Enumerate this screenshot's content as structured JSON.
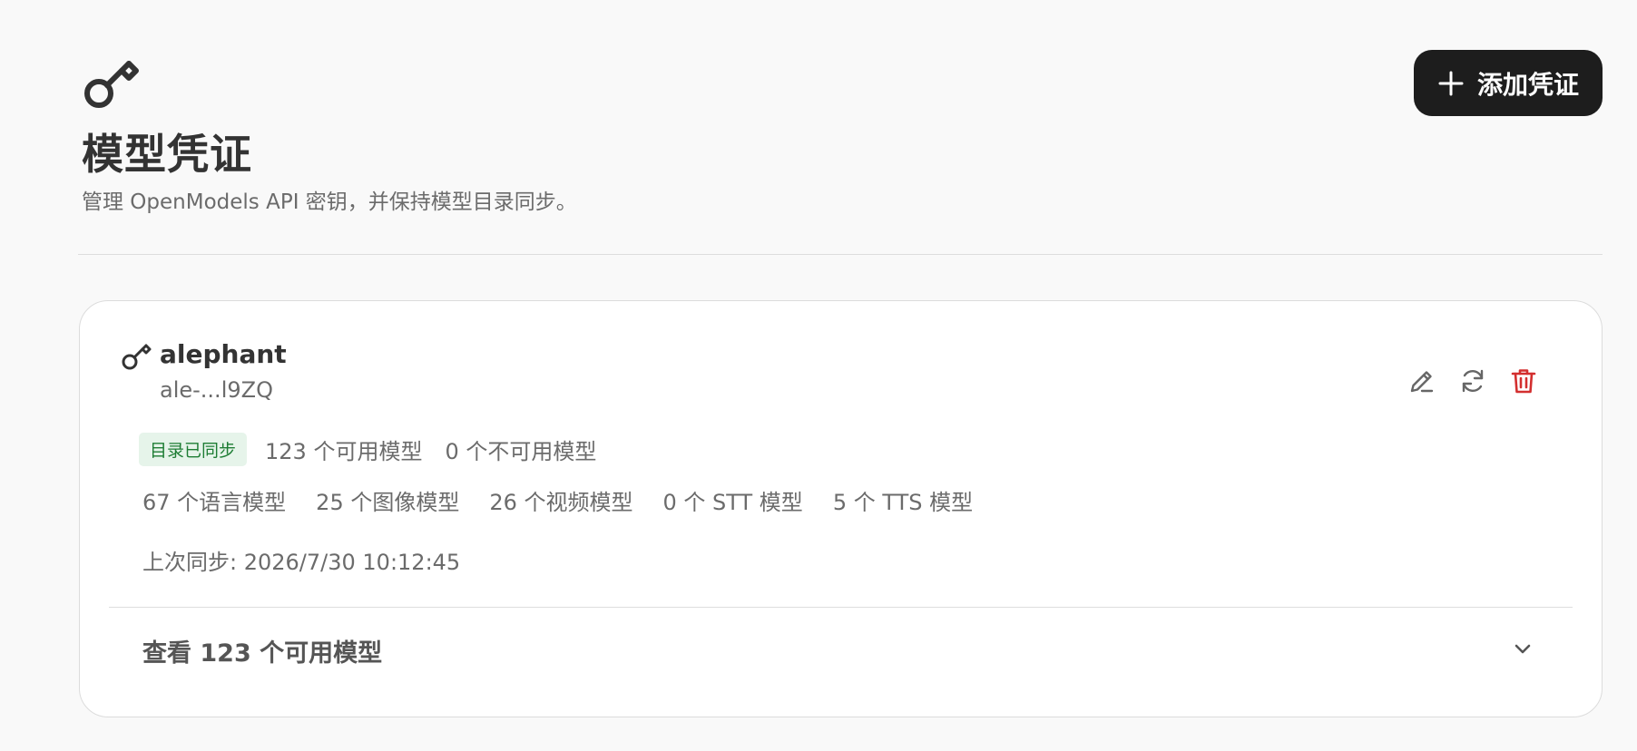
{
  "header": {
    "icon": "key-icon",
    "title": "模型凭证",
    "subtitle": "管理 OpenModels API 密钥，并保持模型目录同步。",
    "add_button_label": "添加凭证"
  },
  "credential": {
    "icon": "key-icon",
    "name": "alephant",
    "masked_key": "ale-...l9ZQ",
    "status_badge": "目录已同步",
    "available_count": "123 个可用模型",
    "unavailable_count": "0 个不可用模型",
    "model_types": [
      "67 个语言模型",
      "25 个图像模型",
      "26 个视频模型",
      "0 个 STT 模型",
      "5 个 TTS 模型"
    ],
    "last_sync": "上次同步: 2026/7/30 10:12:45",
    "view_models_label": "查看 123 个可用模型"
  },
  "colors": {
    "background": "#f9f9f9",
    "primary_button": "#1d1d1d",
    "success_badge_bg": "#e6f4ea",
    "success_badge_text": "#1e7d34",
    "danger": "#d32f2f"
  }
}
